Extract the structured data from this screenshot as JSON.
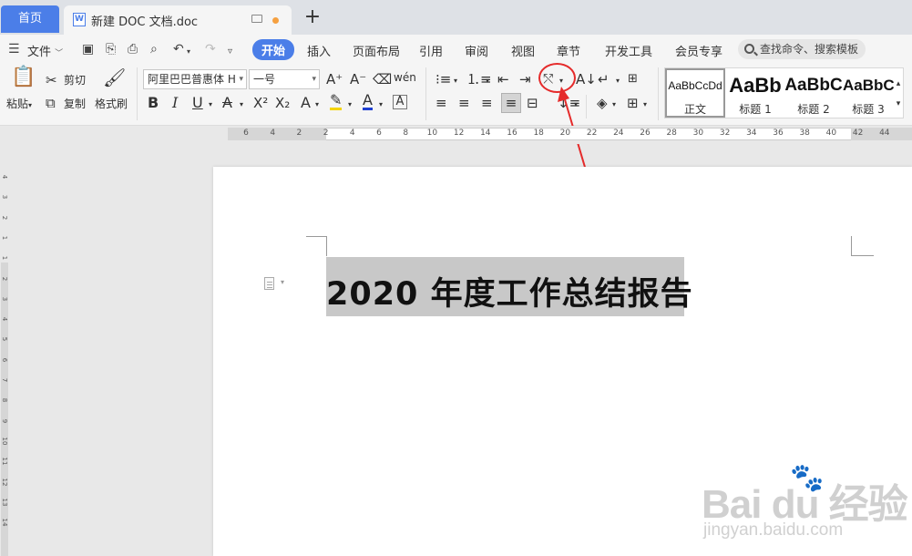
{
  "tabs": {
    "home": "首页",
    "doc": "新建 DOC 文档.doc",
    "add": "+"
  },
  "menu": {
    "file": "文件",
    "items": [
      "开始",
      "插入",
      "页面布局",
      "引用",
      "审阅",
      "视图",
      "章节",
      "开发工具",
      "会员专享"
    ],
    "active": "开始",
    "search_placeholder": "查找命令、搜索模板"
  },
  "ribbon": {
    "paste": "粘贴",
    "cut": "剪切",
    "copy": "复制",
    "format_painter": "格式刷",
    "font_name": "阿里巴巴普惠体 H",
    "font_size": "一号",
    "styles": [
      {
        "preview": "AaBbCcDd",
        "label": "正文"
      },
      {
        "preview": "AaBb",
        "label": "标题 1"
      },
      {
        "preview": "AaBbC",
        "label": "标题 2"
      },
      {
        "preview": "AaBbC",
        "label": "标题 3"
      }
    ]
  },
  "ruler": {
    "labels": [
      "6",
      "4",
      "2",
      "2",
      "4",
      "6",
      "8",
      "10",
      "12",
      "14",
      "16",
      "18",
      "20",
      "22",
      "24",
      "26",
      "28",
      "30",
      "32",
      "34",
      "36",
      "38",
      "40",
      "42",
      "44"
    ],
    "vlabels": [
      "4",
      "3",
      "2",
      "1",
      "1",
      "2",
      "3",
      "4",
      "5",
      "6",
      "7",
      "8",
      "9",
      "10",
      "11",
      "12",
      "13",
      "14"
    ]
  },
  "document": {
    "title": "2020 年度工作总结报告"
  },
  "watermark": {
    "line1": "Bai du 经验",
    "line2": "jingyan.baidu.com"
  },
  "colors": {
    "accent": "#4b7ee8",
    "highlight": "#f5d400",
    "font_color": "#1f3fd0",
    "annotation": "#e52b2b"
  }
}
